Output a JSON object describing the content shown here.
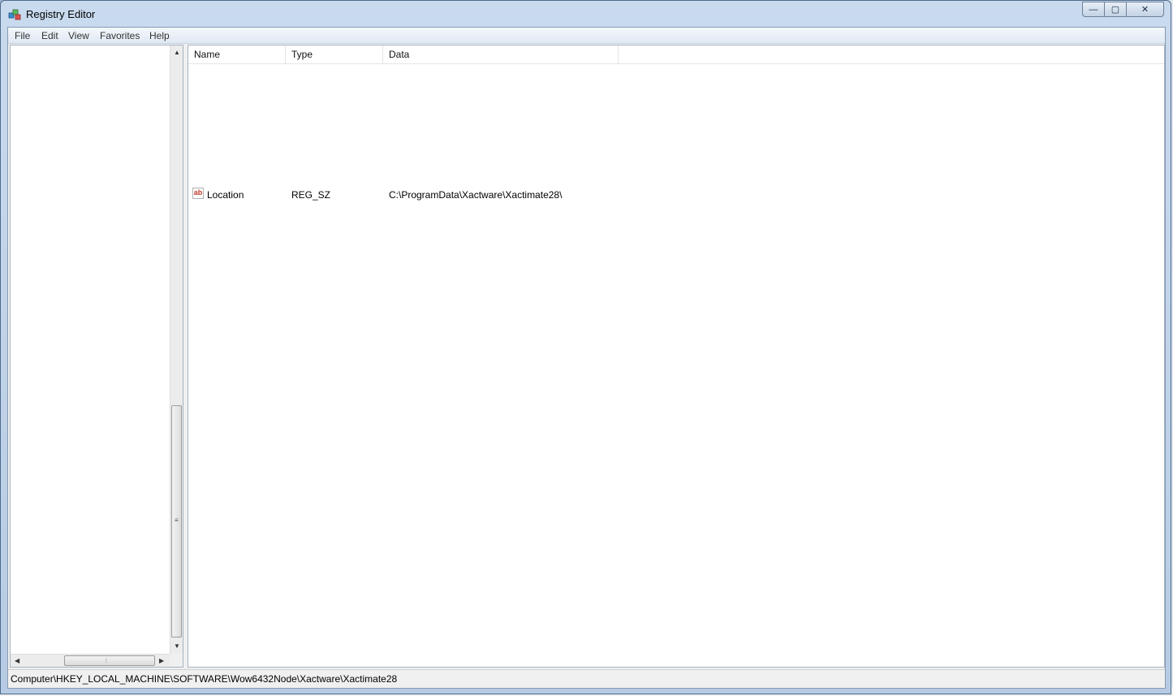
{
  "window": {
    "title": "Registry Editor"
  },
  "caption_buttons": {
    "minimize": "—",
    "maximize": "▢",
    "close": "✕"
  },
  "menu": [
    "File",
    "Edit",
    "View",
    "Favorites",
    "Help"
  ],
  "columns": [
    "Name",
    "Type",
    "Data"
  ],
  "values": [
    {
      "icon": "string-value-icon",
      "icon_text": "ab",
      "name": "Location",
      "type": "REG_SZ",
      "data": "C:\\ProgramData\\Xactware\\Xactimate28\\"
    }
  ],
  "statusbar": {
    "path": "Computer\\HKEY_LOCAL_MACHINE\\SOFTWARE\\Wow6432Node\\Xactware\\Xactimate28"
  },
  "colors": {
    "accent": "#c0392b",
    "frame": "#b6cbe3"
  }
}
